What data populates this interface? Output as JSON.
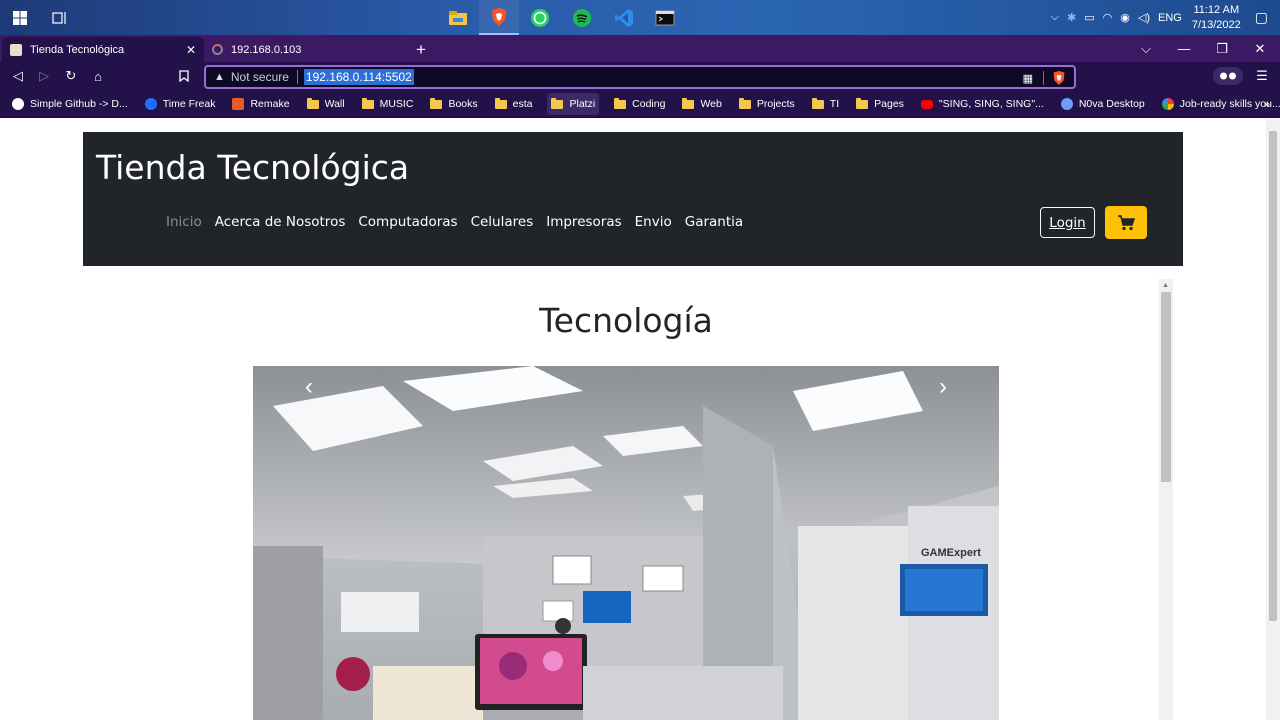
{
  "taskbar": {
    "apps": [
      "file-explorer-icon",
      "brave-icon",
      "whatsapp-icon",
      "spotify-icon",
      "vscode-icon",
      "terminal-icon"
    ],
    "language": "ENG",
    "time": "11:12 AM",
    "date": "7/13/2022"
  },
  "tabs": [
    {
      "title": "Tienda Tecnológica",
      "active": true,
      "close": "✕"
    },
    {
      "title": "192.168.0.103",
      "active": false
    }
  ],
  "new_tab": "+",
  "address_bar": {
    "security_text": "Not secure",
    "url": "192.168.0.114:5502"
  },
  "bookmarks": [
    {
      "label": "Simple Github -> D...",
      "icon": "github-icon"
    },
    {
      "label": "Time Freak",
      "icon": "timefreak-icon"
    },
    {
      "label": "Remake",
      "icon": "remake-icon"
    },
    {
      "label": "Wall",
      "icon": "folder-icon"
    },
    {
      "label": "MUSIC",
      "icon": "folder-icon"
    },
    {
      "label": "Books",
      "icon": "folder-icon"
    },
    {
      "label": "esta",
      "icon": "folder-icon"
    },
    {
      "label": "Platzi",
      "icon": "folder-icon"
    },
    {
      "label": "Coding",
      "icon": "folder-icon"
    },
    {
      "label": "Web",
      "icon": "folder-icon"
    },
    {
      "label": "Projects",
      "icon": "folder-icon"
    },
    {
      "label": "TI",
      "icon": "folder-icon"
    },
    {
      "label": "Pages",
      "icon": "folder-icon"
    },
    {
      "label": "\"SING, SING, SING\"...",
      "icon": "youtube-icon"
    },
    {
      "label": "N0va Desktop",
      "icon": "nova-icon"
    },
    {
      "label": "Job-ready skills you...",
      "icon": "google-icon"
    }
  ],
  "bookmarks_more": "»",
  "site": {
    "brand": "Tienda Tecnológica",
    "nav": [
      "Inicio",
      "Acerca de Nosotros",
      "Computadoras",
      "Celulares",
      "Impresoras",
      "Envio",
      "Garantia"
    ],
    "login_label": "Login",
    "heading": "Tecnología",
    "carousel": {
      "prev": "‹",
      "next": "›",
      "brand_sign": "GAMExpert"
    }
  },
  "colors": {
    "navbar": "#212529",
    "cart_button": "#ffc107",
    "browser_chrome": "#23124a",
    "tab_strip": "#3c1a63"
  }
}
